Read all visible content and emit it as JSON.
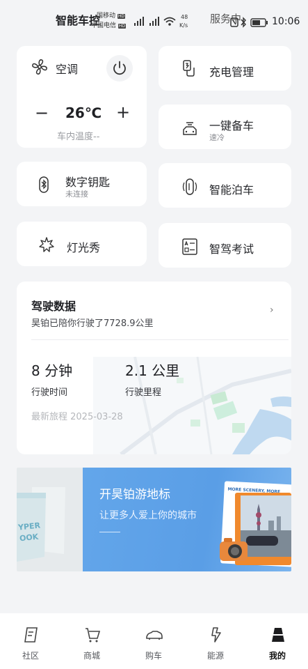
{
  "status": {
    "title": "智能车控",
    "carrier1": "国移动",
    "carrier1_badge": "HD",
    "carrier2": "中国电信",
    "carrier2_badge": "HD",
    "net_speed": "48",
    "net_unit": "K/s",
    "service": "服务中",
    "time": "10:06"
  },
  "ac": {
    "label": "空调",
    "temp": "26℃",
    "minus": "−",
    "plus": "+",
    "interior": "车内温度--"
  },
  "controls": {
    "charging": "充电管理",
    "prepare": "一键备车",
    "prepare_sub": "速冷",
    "key": "数字钥匙",
    "key_sub": "未连接",
    "parking": "智能泊车",
    "lights": "灯光秀",
    "exam": "智驾考试"
  },
  "driving": {
    "title": "驾驶数据",
    "subtitle": "昊铂已陪你行驶了7728.9公里",
    "arrow": "›",
    "time_value": "8 分钟",
    "time_label": "行驶时间",
    "distance_value": "2.1 公里",
    "distance_label": "行驶里程",
    "latest": "最新旅程 2025-03-28"
  },
  "banner": {
    "title": "开昊铂游地标",
    "subtitle": "让更多人爱上你的城市",
    "postcard_text": "MORE SCENERY, MORE",
    "book_text": "YPER",
    "book_text2": "OOK"
  },
  "nav": [
    {
      "label": "社区"
    },
    {
      "label": "商城"
    },
    {
      "label": "购车"
    },
    {
      "label": "能源"
    },
    {
      "label": "我的"
    }
  ],
  "colors": {
    "banner_blue": "#5a9ee6",
    "accent_orange": "#f08a2c"
  }
}
